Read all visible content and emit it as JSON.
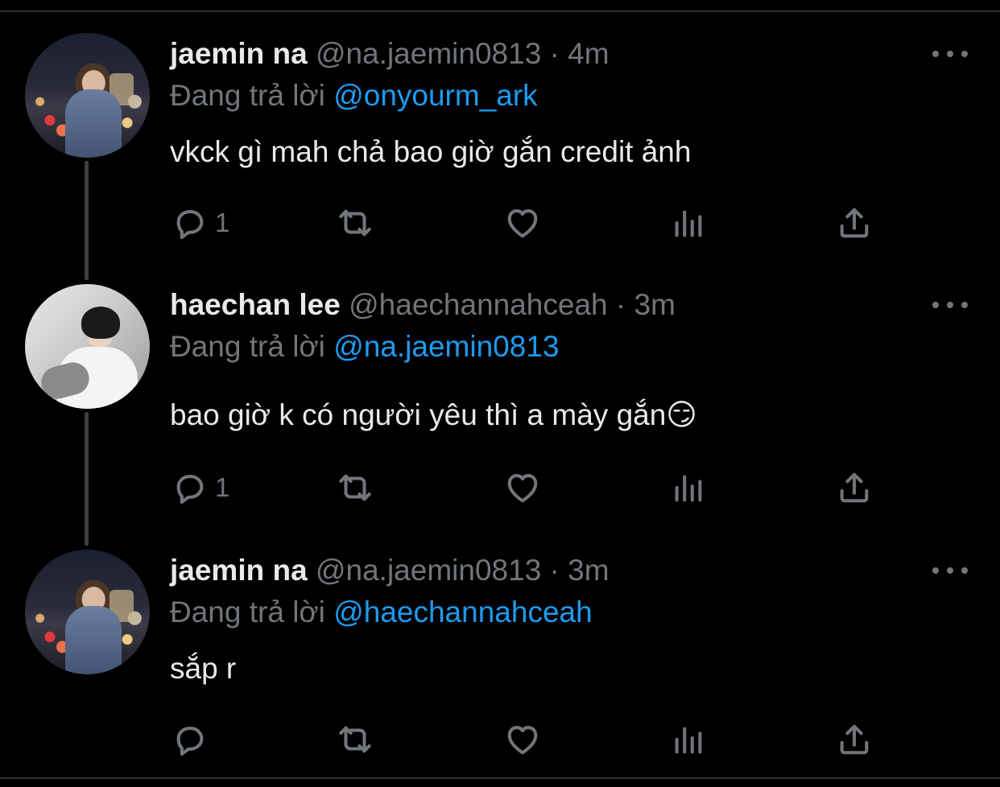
{
  "colors": {
    "background": "#000000",
    "text_primary": "#e7e9ea",
    "text_secondary": "#71767b",
    "link": "#1d9bf0",
    "thread_line": "#3c4043"
  },
  "tweets": [
    {
      "display_name": "jaemin na",
      "handle_time": "@na.jaemin0813 · 4m",
      "reply_prefix": "Đang trả lời",
      "reply_to": "@onyourm_ark",
      "text": "vkck gì mah chả bao giờ gắn credit ảnh",
      "reply_count": "1",
      "icons": [
        "reply-icon",
        "retweet-icon",
        "like-icon",
        "views-icon",
        "share-icon",
        "more-icon"
      ]
    },
    {
      "display_name": "haechan lee",
      "handle_time": "@haechannahceah · 3m",
      "reply_prefix": "Đang trả lời",
      "reply_to": "@na.jaemin0813",
      "text": "bao giờ k có người yêu thì a mày gắn😏",
      "reply_count": "1",
      "icons": [
        "reply-icon",
        "retweet-icon",
        "like-icon",
        "views-icon",
        "share-icon",
        "more-icon"
      ]
    },
    {
      "display_name": "jaemin na",
      "handle_time": "@na.jaemin0813 · 3m",
      "reply_prefix": "Đang trả lời",
      "reply_to": "@haechannahceah",
      "text": "sắp r",
      "reply_count": "",
      "icons": [
        "reply-icon",
        "retweet-icon",
        "like-icon",
        "views-icon",
        "share-icon",
        "more-icon"
      ]
    }
  ]
}
